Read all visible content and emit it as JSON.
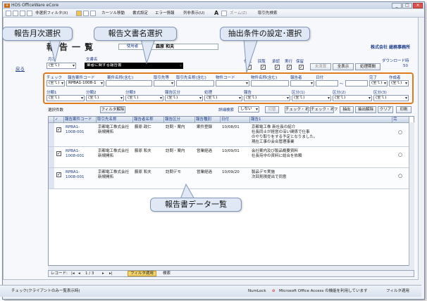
{
  "app": {
    "title": "HOS OfficeWare eCore"
  },
  "toolbar": {
    "filter_label": "非選択フィルタ(X)",
    "cursor_move": "カーソル移動",
    "doc_settings": "書式設定",
    "error_info": "エラー情報",
    "column_display": "列非表示(U)",
    "zoom": "ズーム(Z)",
    "client_search": "取引先検索"
  },
  "header": {
    "page_title": "報告一覧",
    "user_label": "使用者",
    "user_name": "森原 和夫",
    "company": "株式会社 総務事務所",
    "back": "戻る",
    "download": "ダウンロード時"
  },
  "month_field": {
    "label": "月次",
    "value": "(全て)"
  },
  "docname_field": {
    "label": "文書名",
    "value": "業者に関する報告書"
  },
  "flags": {
    "labels": [
      "作成",
      "回覧",
      "承認",
      "実行",
      "保留"
    ],
    "states": [
      "✓",
      "✓",
      "✓",
      "✓",
      "✓"
    ]
  },
  "top_buttons": {
    "mark": "未清算",
    "show_all": "全表示",
    "process": "処理期間",
    "count": "50"
  },
  "filters": {
    "row1_labels": [
      "チェック",
      "報告案件コード",
      "案件名称(含む)",
      "取引先等",
      "取引先名称(含む)",
      "物件コード",
      "物件名称(含む)",
      "報告者",
      "日付",
      "完了",
      "作成者"
    ],
    "row1_values": [
      "(全て)",
      "RPBA1-1008-1",
      "",
      "",
      "",
      "",
      "",
      "",
      "",
      "(全て)",
      "(全て)"
    ],
    "row2_labels": [
      "分類1",
      "分類2",
      "分類3",
      "報告区分",
      "処理",
      "報告",
      "区分(1)",
      "区分(2)",
      "区分(3)"
    ],
    "row2_values": [
      "(全て)",
      "(全て)",
      "(全て)",
      "(全て)",
      "(全て)",
      "(全て)",
      "(全て)",
      "(全て)",
      "(全て)"
    ]
  },
  "action_bar": {
    "count_text": "選択件数",
    "filter_btn": "フィルタ解除",
    "detail_label": "詳細検索",
    "detail_value": "しない",
    "cut": "切替",
    "check_on": "チェック・オン",
    "check_off": "チェック・オフ",
    "extract": "抽出",
    "extract_release": "抽出解除",
    "clear": "クリア",
    "print": "印刷"
  },
  "table": {
    "headers": [
      "✓",
      "報告案件コード",
      "取引先名称",
      "報告者名称",
      "報告区分",
      "報告種別",
      "日付",
      "報告1",
      "完"
    ],
    "rows": [
      {
        "check": "✓",
        "code": "RPBA1-\n1008-001",
        "client": "京都電工株式会社\n新規開拓",
        "reporter": "藤原 政仁",
        "kind": "訪問・案内",
        "type": "案件登録",
        "date": "10/08/01",
        "report": "京都電工株 新社長の紹介\n社長同士が経営の深い関係で仕事\nのやり取りをする予定となりました。\n現在工事の会合管理事業",
        "done": "○"
      },
      {
        "check": "✓",
        "code": "RPBA1-\n1008-001",
        "client": "京都電工株式会社\n新規開拓",
        "reporter": "藤原 和夫",
        "kind": "訪問・案内",
        "type": "営業経過",
        "date": "10/09/01",
        "report": "会社案内及び製品概要資料\n社長宛中の資料に総合を依頼",
        "done": "○"
      },
      {
        "check": "✓",
        "code": "RPBA1-\n1008-001",
        "client": "京都電工株式会社\n新規開拓",
        "reporter": "藤原 和夫",
        "kind": "訪問デモ",
        "type": "営業経過",
        "date": "10/09/20",
        "report": "製品デモ実施\n次回見積提出で同意",
        "done": "○"
      }
    ]
  },
  "navbar": {
    "record_label": "レコード:",
    "position": "1 / 3",
    "filter": "フィルタ適用",
    "search": "検索"
  },
  "statusbar": {
    "left": "チェック(クライアントのみー覧表示時)",
    "numlock": "NumLock",
    "access": "Microsoft Office Access の機能を利用しています",
    "filter": "フィルタ適用"
  },
  "callouts": {
    "month": "報告月次選択",
    "docname": "報告文書名選択",
    "conditions": "抽出条件の設定･選択",
    "data": "報告書データ一覧"
  },
  "colors": {
    "accent": "#e07c1c",
    "callout_bg": "#dfe8f4",
    "title_blue": "#1a3a8a"
  }
}
